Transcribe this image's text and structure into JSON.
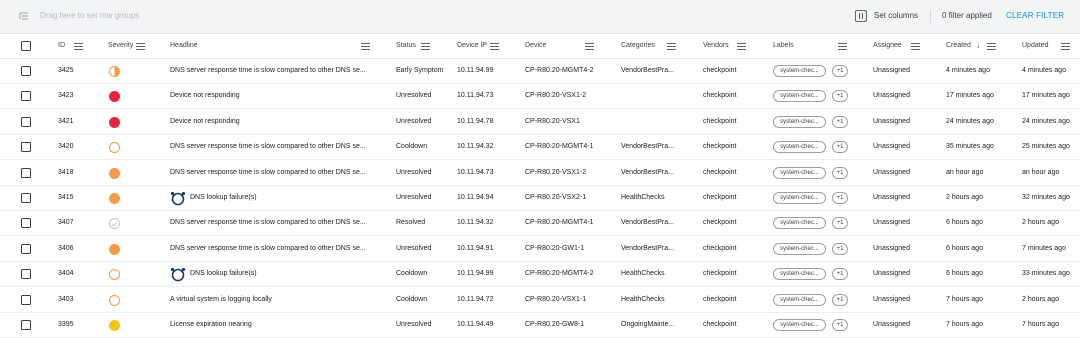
{
  "toolbar": {
    "drag_hint": "Drag here to set row groups",
    "set_columns": "Set columns",
    "filter_applied": "0 filter applied",
    "clear_filter": "CLEAR FILTER"
  },
  "columns": {
    "id": "ID",
    "severity": "Severity",
    "headline": "Headline",
    "status": "Status",
    "device_ip": "Device IP",
    "device": "Device",
    "categories": "Categories",
    "vendors": "Vendors",
    "labels": "Labels",
    "assignee": "Assignee",
    "created": "Created",
    "updated": "Updated"
  },
  "rows": [
    {
      "id": "3425",
      "severity": "half",
      "headline": "DNS server response time is slow compared to other DNS se...",
      "headline_icon": "",
      "status": "Early Symptom",
      "ip": "10.11.94.99",
      "device": "CP-R80.20-MGMT4-2",
      "category": "VendorBestPra...",
      "vendor": "checkpoint",
      "label": "system-chec...",
      "more": "+1",
      "assignee": "Unassigned",
      "created": "4 minutes ago",
      "updated": "4 minutes ago"
    },
    {
      "id": "3423",
      "severity": "red",
      "headline": "Device not responding",
      "headline_icon": "",
      "status": "Unresolved",
      "ip": "10.11.94.73",
      "device": "CP-R80.20-VSX1-2",
      "category": "",
      "vendor": "checkpoint",
      "label": "system-chec...",
      "more": "+1",
      "assignee": "Unassigned",
      "created": "17 minutes ago",
      "updated": "17 minutes ago"
    },
    {
      "id": "3421",
      "severity": "red",
      "headline": "Device not responding",
      "headline_icon": "",
      "status": "Unresolved",
      "ip": "10.11.94.78",
      "device": "CP-R80.20-VSX1",
      "category": "",
      "vendor": "checkpoint",
      "label": "system-chec...",
      "more": "+1",
      "assignee": "Unassigned",
      "created": "24 minutes ago",
      "updated": "24 minutes ago"
    },
    {
      "id": "3420",
      "severity": "orange-ring",
      "headline": "DNS server response time is slow compared to other DNS se...",
      "headline_icon": "",
      "status": "Cooldown",
      "ip": "10.11.94.32",
      "device": "CP-R80.20-MGMT4-1",
      "category": "VendorBestPra...",
      "vendor": "checkpoint",
      "label": "system-chec...",
      "more": "+1",
      "assignee": "Unassigned",
      "created": "35 minutes ago",
      "updated": "25 minutes ago"
    },
    {
      "id": "3418",
      "severity": "orange",
      "headline": "DNS server response time is slow compared to other DNS se...",
      "headline_icon": "",
      "status": "Unresolved",
      "ip": "10.11.94.73",
      "device": "CP-R80.20-VSX1-2",
      "category": "VendorBestPra...",
      "vendor": "checkpoint",
      "label": "system-chec...",
      "more": "+1",
      "assignee": "Unassigned",
      "created": "an hour ago",
      "updated": "an hour ago"
    },
    {
      "id": "3415",
      "severity": "orange",
      "headline": "DNS lookup failure(s)",
      "headline_icon": "healthcheck",
      "status": "Unresolved",
      "ip": "10.11.94.94",
      "device": "CP-R80.20-VSX2-1",
      "category": "HealthChecks",
      "vendor": "checkpoint",
      "label": "system-chec...",
      "more": "+1",
      "assignee": "Unassigned",
      "created": "2 hours ago",
      "updated": "32 minutes ago"
    },
    {
      "id": "3407",
      "severity": "resolved",
      "headline": "DNS server response time is slow compared to other DNS se...",
      "headline_icon": "",
      "status": "Resolved",
      "ip": "10.11.94.32",
      "device": "CP-R80.20-MGMT4-1",
      "category": "VendorBestPra...",
      "vendor": "checkpoint",
      "label": "system-chec...",
      "more": "+1",
      "assignee": "Unassigned",
      "created": "6 hours ago",
      "updated": "2 hours ago"
    },
    {
      "id": "3406",
      "severity": "orange",
      "headline": "DNS server response time is slow compared to other DNS se...",
      "headline_icon": "",
      "status": "Unresolved",
      "ip": "10.11.94.91",
      "device": "CP-R80.20-GW1-1",
      "category": "VendorBestPra...",
      "vendor": "checkpoint",
      "label": "system-chec...",
      "more": "+1",
      "assignee": "Unassigned",
      "created": "6 hours ago",
      "updated": "7 minutes ago"
    },
    {
      "id": "3404",
      "severity": "orange-ring",
      "headline": "DNS lookup failure(s)",
      "headline_icon": "healthcheck",
      "status": "Cooldown",
      "ip": "10.11.94.99",
      "device": "CP-R80.20-MGMT4-2",
      "category": "HealthChecks",
      "vendor": "checkpoint",
      "label": "system-chec...",
      "more": "+1",
      "assignee": "Unassigned",
      "created": "6 hours ago",
      "updated": "33 minutes ago"
    },
    {
      "id": "3403",
      "severity": "orange-ring",
      "headline": "A virtual system is logging locally",
      "headline_icon": "",
      "status": "Cooldown",
      "ip": "10.11.94.72",
      "device": "CP-R80.20-VSX1-1",
      "category": "HealthChecks",
      "vendor": "checkpoint",
      "label": "system-chec...",
      "more": "+1",
      "assignee": "Unassigned",
      "created": "7 hours ago",
      "updated": "2 hours ago"
    },
    {
      "id": "3395",
      "severity": "yellow",
      "headline": "License expiration nearing",
      "headline_icon": "",
      "status": "Unresolved",
      "ip": "10.11.94.49",
      "device": "CP-R80.20-GW8-1",
      "category": "OngoingMainte...",
      "vendor": "checkpoint",
      "label": "system-chec...",
      "more": "+1",
      "assignee": "Unassigned",
      "created": "7 hours ago",
      "updated": "7 hours ago"
    }
  ]
}
